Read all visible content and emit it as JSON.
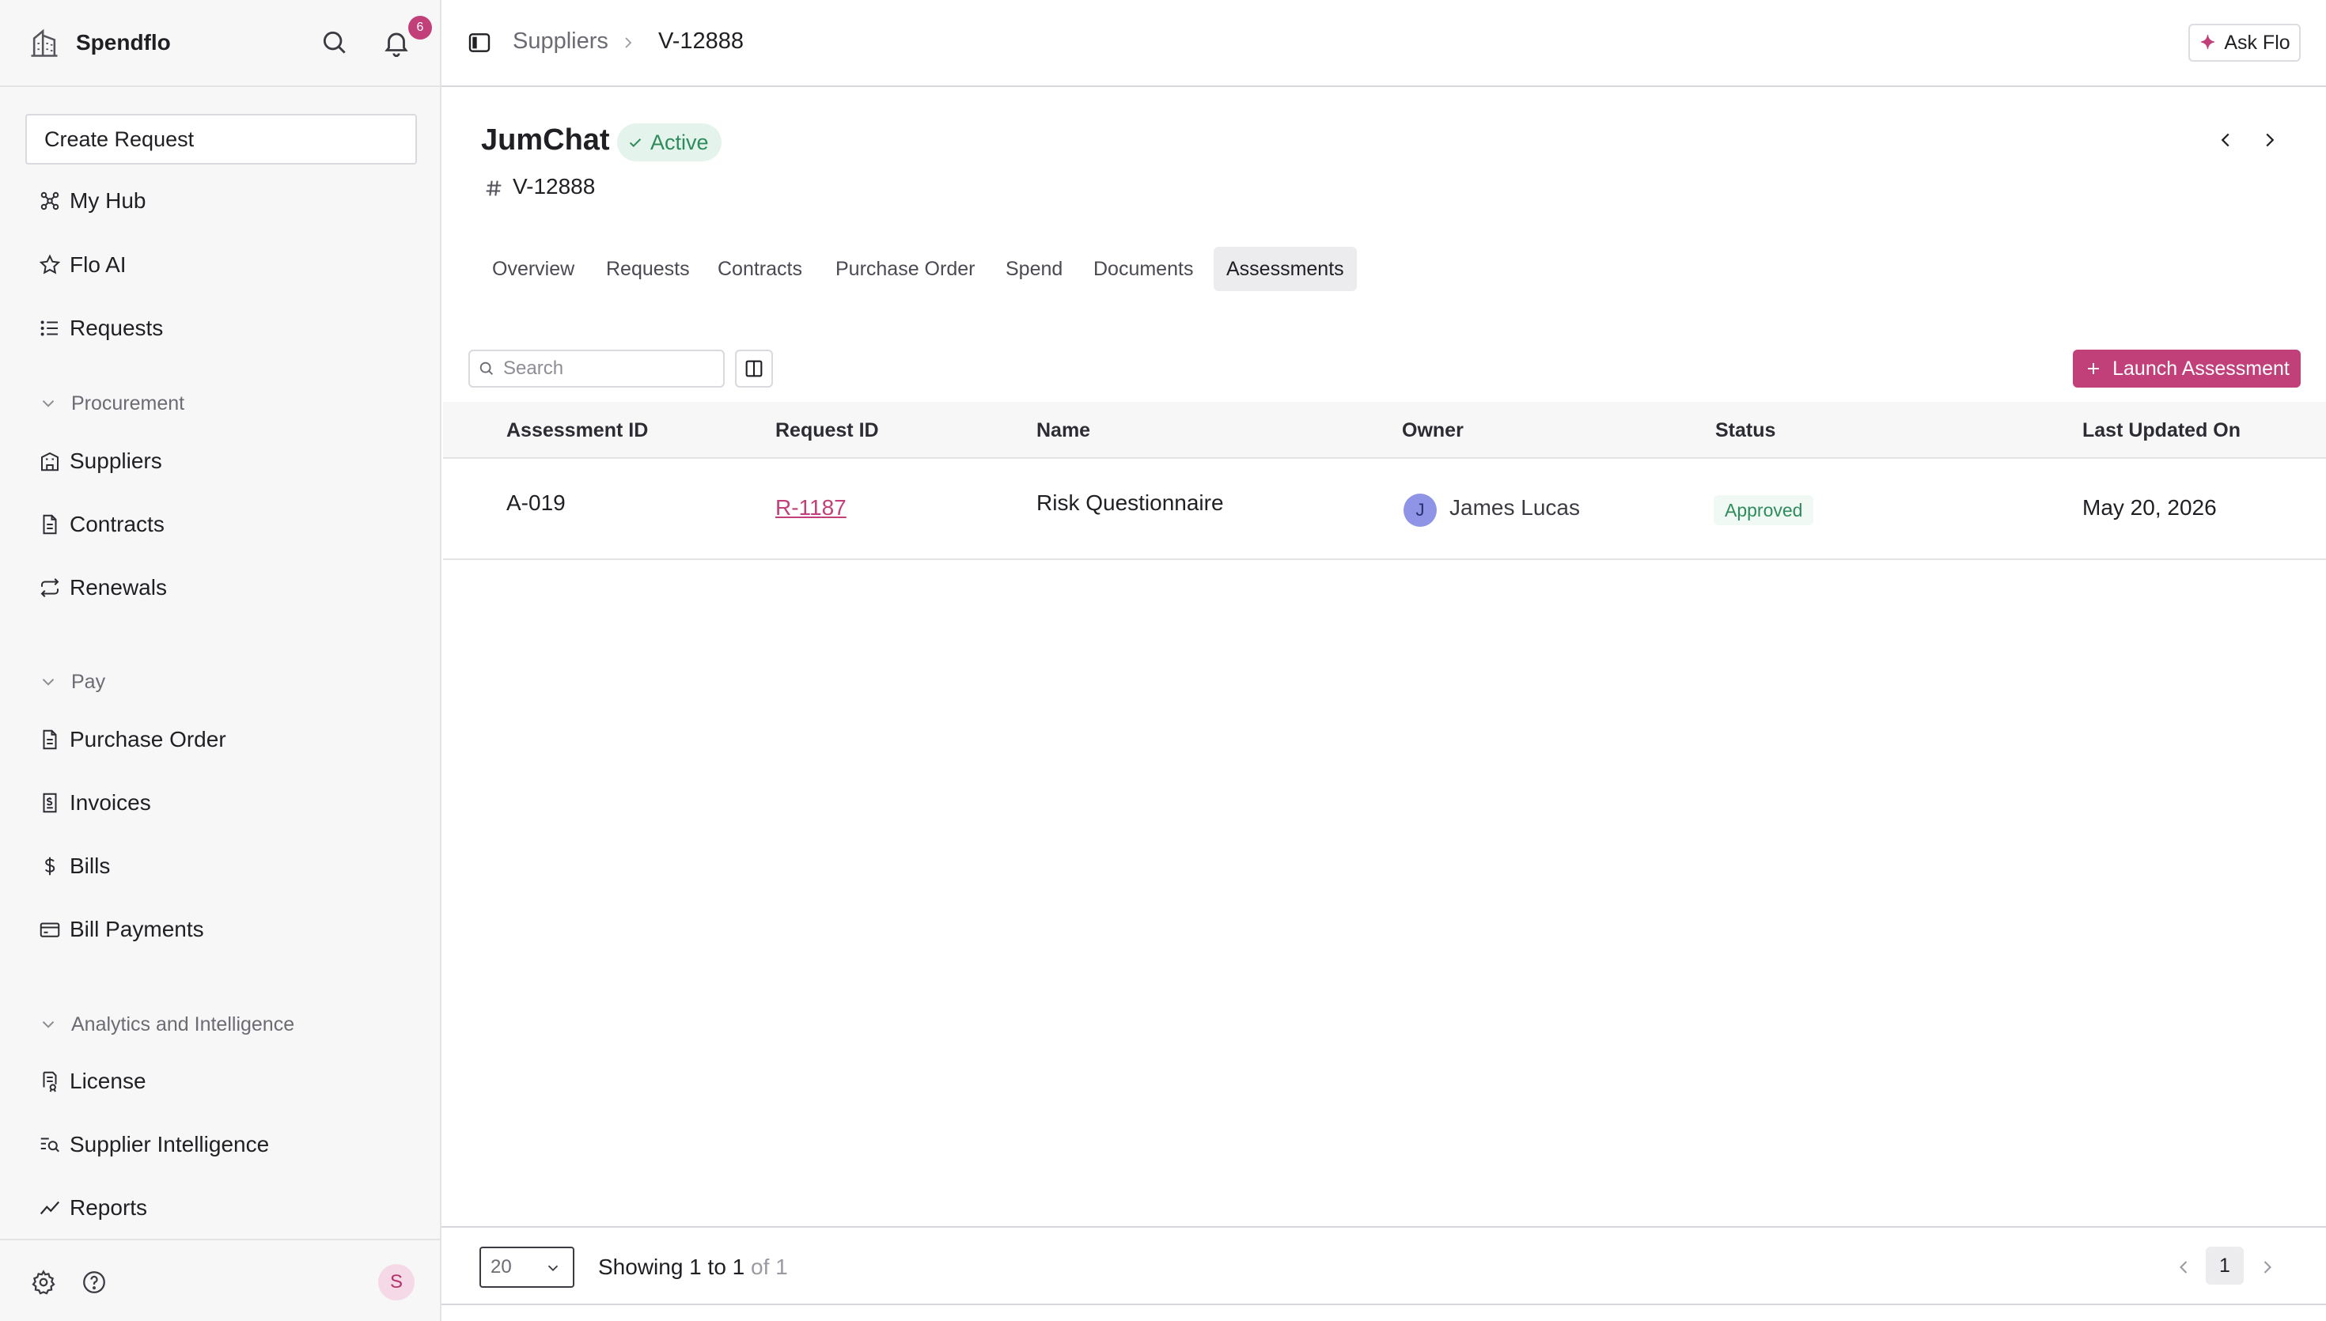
{
  "sidebar": {
    "brand": "Spendflo",
    "notification_count": "6",
    "create_request_label": "Create Request",
    "top_items": [
      {
        "label": "My Hub",
        "icon": "hub-icon"
      },
      {
        "label": "Flo AI",
        "icon": "star-icon"
      },
      {
        "label": "Requests",
        "icon": "list-icon"
      }
    ],
    "sections": [
      {
        "label": "Procurement",
        "items": [
          {
            "label": "Suppliers",
            "icon": "building-icon"
          },
          {
            "label": "Contracts",
            "icon": "document-icon"
          },
          {
            "label": "Renewals",
            "icon": "repeat-icon"
          }
        ]
      },
      {
        "label": "Pay",
        "items": [
          {
            "label": "Purchase Order",
            "icon": "document-icon"
          },
          {
            "label": "Invoices",
            "icon": "receipt-icon"
          },
          {
            "label": "Bills",
            "icon": "dollar-icon"
          },
          {
            "label": "Bill Payments",
            "icon": "card-icon"
          }
        ]
      },
      {
        "label": "Analytics and Intelligence",
        "items": [
          {
            "label": "License",
            "icon": "license-icon"
          },
          {
            "label": "Supplier Intelligence",
            "icon": "search-list-icon"
          },
          {
            "label": "Reports",
            "icon": "chart-line-icon"
          }
        ]
      }
    ],
    "user_initial": "S"
  },
  "topbar": {
    "breadcrumb": [
      "Suppliers",
      "V-12888"
    ],
    "ask_flo_label": "Ask Flo"
  },
  "supplier": {
    "name": "JumChat",
    "status": "Active",
    "id": "V-12888"
  },
  "tabs": [
    {
      "label": "Overview",
      "active": false
    },
    {
      "label": "Requests",
      "active": false
    },
    {
      "label": "Contracts",
      "active": false
    },
    {
      "label": "Purchase Order",
      "active": false
    },
    {
      "label": "Spend",
      "active": false
    },
    {
      "label": "Documents",
      "active": false
    },
    {
      "label": "Assessments",
      "active": true
    }
  ],
  "toolbar": {
    "search_placeholder": "Search",
    "launch_label": "Launch Assessment"
  },
  "table": {
    "columns": [
      "Assessment ID",
      "Request ID",
      "Name",
      "Owner",
      "Status",
      "Last Updated On"
    ],
    "rows": [
      {
        "assessment_id": "A-019",
        "request_id": "R-1187",
        "name": "Risk Questionnaire",
        "owner_initial": "J",
        "owner": "James Lucas",
        "status": "Approved",
        "last_updated": "May 20, 2026"
      }
    ]
  },
  "pagination": {
    "page_size": "20",
    "showing": "Showing 1 to 1",
    "of_total": "of 1",
    "current_page": "1"
  },
  "colors": {
    "accent": "#c2407a",
    "success": "#2e8b5c",
    "success_bg": "#e4f4ec",
    "avatar_owner": "#8f94e6"
  }
}
